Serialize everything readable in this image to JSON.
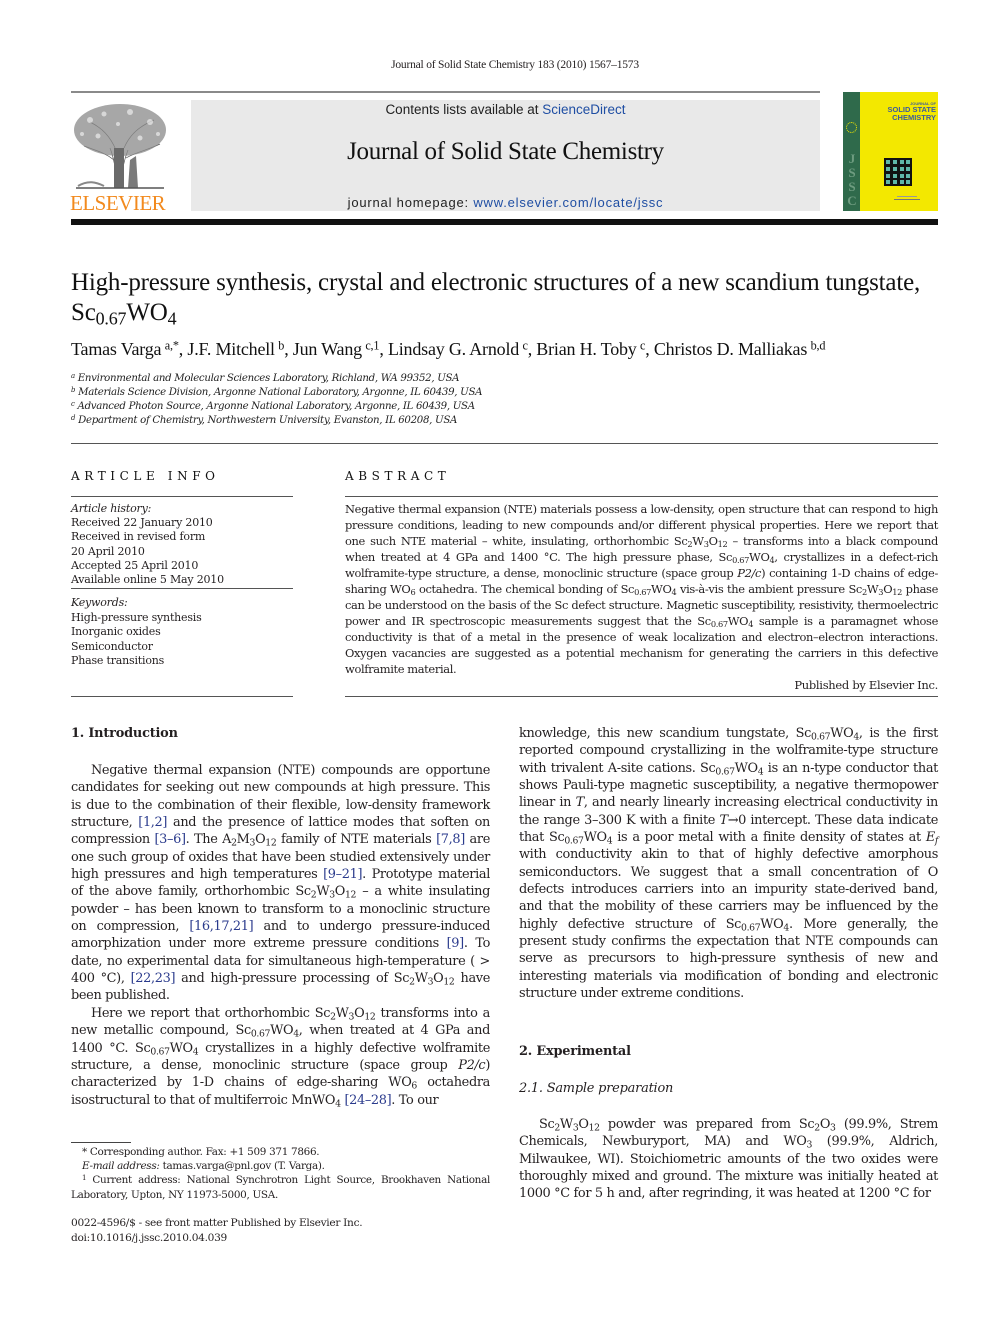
{
  "header": {
    "running_head": "Journal of Solid State Chemistry 183 (2010) 1567–1573",
    "contents_prefix": "Contents lists available at ",
    "contents_link": "ScienceDirect",
    "journal_name": "Journal of Solid State Chemistry",
    "homepage_prefix": "journal homepage: ",
    "homepage_link": "www.elsevier.com/locate/jssc",
    "publisher_logo_text": "ELSEVIER",
    "cover": {
      "small_title": "JOURNAL OF",
      "title_line1": "SOLID STATE",
      "title_line2": "CHEMISTRY",
      "spine_letters": [
        "J",
        "S",
        "S",
        "C"
      ],
      "colors": {
        "background": "#f3e800",
        "spine": "#2f6a4b",
        "title": "#3d5c9b"
      }
    },
    "colors": {
      "elsevier_orange": "#f28a1e",
      "link_blue": "#1f4ea3",
      "banner_gray": "#e9e9e9"
    }
  },
  "article": {
    "title_main": "High-pressure synthesis, crystal and electronic structures of a new scandium tungstate, Sc",
    "title_sub1": "0.67",
    "title_mid": "WO",
    "title_sub2": "4",
    "authors": [
      {
        "name": "Tamas Varga",
        "sup": "a,*"
      },
      {
        "name": "J.F. Mitchell",
        "sup": "b"
      },
      {
        "name": "Jun Wang",
        "sup": "c,1"
      },
      {
        "name": "Lindsay G. Arnold",
        "sup": "c"
      },
      {
        "name": "Brian H. Toby",
        "sup": "c"
      },
      {
        "name": "Christos D. Malliakas",
        "sup": "b,d"
      }
    ],
    "affiliations": [
      {
        "key": "a",
        "text": "Environmental and Molecular Sciences Laboratory, Richland, WA 99352, USA"
      },
      {
        "key": "b",
        "text": "Materials Science Division, Argonne National Laboratory, Argonne, IL 60439, USA"
      },
      {
        "key": "c",
        "text": "Advanced Photon Source, Argonne National Laboratory, Argonne, IL 60439, USA"
      },
      {
        "key": "d",
        "text": "Department of Chemistry, Northwestern University, Evanston, IL 60208, USA"
      }
    ]
  },
  "article_info": {
    "label": "ARTICLE INFO",
    "history_label": "Article history:",
    "history": [
      "Received 22 January 2010",
      "Received in revised form",
      "20 April 2010",
      "Accepted 25 April 2010",
      "Available online 5 May 2010"
    ],
    "keywords_label": "Keywords:",
    "keywords": [
      "High-pressure synthesis",
      "Inorganic oxides",
      "Semiconductor",
      "Phase transitions"
    ]
  },
  "abstract": {
    "label": "ABSTRACT",
    "t1": "Negative thermal expansion (NTE) materials possess a low-density, open structure that can respond to high pressure conditions, leading to new compounds and/or different physical properties. Here we report that one such NTE material – white, insulating, orthorhombic Sc",
    "t2": " – transforms into a black compound when treated at 4 GPa and 1400 °C. The high pressure phase, Sc",
    "t3": ", crystallizes in a defect-rich wolframite-type structure, a dense, monoclinic structure (space group ",
    "t3_italic": "P2/c",
    "t4": ") containing 1-D chains of edge-sharing WO",
    "t5": " octahedra. The chemical bonding of Sc",
    "t6": " vis-à-vis the ambient pressure Sc",
    "t7": " phase can be understood on the basis of the Sc defect structure. Magnetic susceptibility, resistivity, thermoelectric power and IR spectroscopic measurements suggest that the Sc",
    "t8": " sample is a paramagnet whose conductivity is that of a metal in the presence of weak localization and electron–electron interactions. Oxygen vacancies are suggested as a potential mechanism for generating the carriers in this defective wolframite material.",
    "published_by": "Published by Elsevier Inc."
  },
  "formula": {
    "sc": "Sc",
    "w": "W",
    "o": "O",
    "wo": "WO",
    "a": "A",
    "m": "M",
    "mnwo": "MnWO",
    "sc2o": "Sc",
    "n2": "2",
    "n3": "3",
    "n4": "4",
    "n6": "6",
    "n12": "12",
    "n067": "0.67"
  },
  "introduction": {
    "heading": "1.  Introduction",
    "p1_a": "Negative thermal expansion (NTE) compounds are opportune candidates for seeking out new compounds at high pressure. This is due to the combination of their flexible, low-density framework structure, ",
    "ref1": "[1,2]",
    "p1_b": " and the presence of lattice modes that soften on compression ",
    "ref2": "[3–6]",
    "p1_c": ". The A",
    "p1_d": " family of NTE materials ",
    "ref3": "[7,8]",
    "p1_e": " are one such group of oxides that have been studied extensively under high pressures and high temperatures ",
    "ref4": "[9–21]",
    "p1_f": ". Prototype material of the above family, orthorhombic Sc",
    "p1_g": " – a white insulating powder – has been known to transform to a monoclinic structure on compression, ",
    "ref5": "[16,17,21]",
    "p1_h": " and to undergo pressure-induced amorphization under more extreme pressure conditions ",
    "ref6": "[9]",
    "p1_i": ". To date, no experimental data for simultaneous high-temperature ( > 400 °C), ",
    "ref7": "[22,23]",
    "p1_j": " and high-pressure processing of Sc",
    "p1_k": " have been published.",
    "p2_a": "Here we report that orthorhombic Sc",
    "p2_b": " transforms into a new metallic compound, Sc",
    "p2_c": ", when treated at 4 GPa and 1400 °C. Sc",
    "p2_d": " crystallizes in a highly defective wolframite structure, a dense, monoclinic structure (space group ",
    "p2_e_italic": "P2/c",
    "p2_f": ") characterized by 1-D chains of edge-sharing WO",
    "p2_g": " octahedra isostructural to that of multiferroic MnWO",
    "ref8": "[24–28]",
    "p2_h": ". To our",
    "p3_a": "knowledge, this new scandium tungstate, Sc",
    "p3_b": ", is the first reported compound crystallizing in the wolframite-type structure with trivalent A-site cations. Sc",
    "p3_c": " is an n-type conductor that shows Pauli-type magnetic susceptibility, a negative thermopower linear in ",
    "p3_T": "T",
    "p3_d": ", and nearly linearly increasing electrical conductivity in the range 3–300 K with a finite ",
    "p3_e": "→0 intercept. These data indicate that Sc",
    "p3_f": " is a poor metal with a finite density of states at ",
    "p3_Ef": "E",
    "p3_Ef_sub": "f",
    "p3_g": " with conductivity akin to that of highly defective amorphous semiconductors. We suggest that a small concentration of O defects introduces carriers into an impurity state-derived band, and that the mobility of these carriers may be influenced by the highly defective structure of Sc",
    "p3_h": ". More generally, the present study confirms the expectation that NTE compounds can serve as precursors to high-pressure synthesis of new and interesting materials via modification of bonding and electronic structure under extreme conditions."
  },
  "experimental": {
    "heading": "2.  Experimental",
    "subheading": "2.1.  Sample preparation",
    "p_a": " powder was prepared from Sc",
    "p_b": " (99.9%, Strem Chemicals, Newburyport, MA) and WO",
    "p_c": " (99.9%, Aldrich, Milwaukee, WI). Stoichiometric amounts of the two oxides were thoroughly mixed and ground. The mixture was initially heated at 1000 °C for 5 h and, after regrinding, it was heated at 1200 °C for"
  },
  "footnotes": {
    "corresponding_mark": "*",
    "corresponding": " Corresponding author. Fax: +1 509 371 7866.",
    "email_label": "E-mail address:",
    "email": " tamas.varga@pnl.gov (T. Varga).",
    "current_mark": "1",
    "current": " Current address: National Synchrotron Light Source, Brookhaven National Laboratory, Upton, NY 11973-5000, USA."
  },
  "front_matter": {
    "issn_line": "0022-4596/$ - see front matter Published by Elsevier Inc.",
    "doi": "doi:10.1016/j.jssc.2010.04.039"
  }
}
